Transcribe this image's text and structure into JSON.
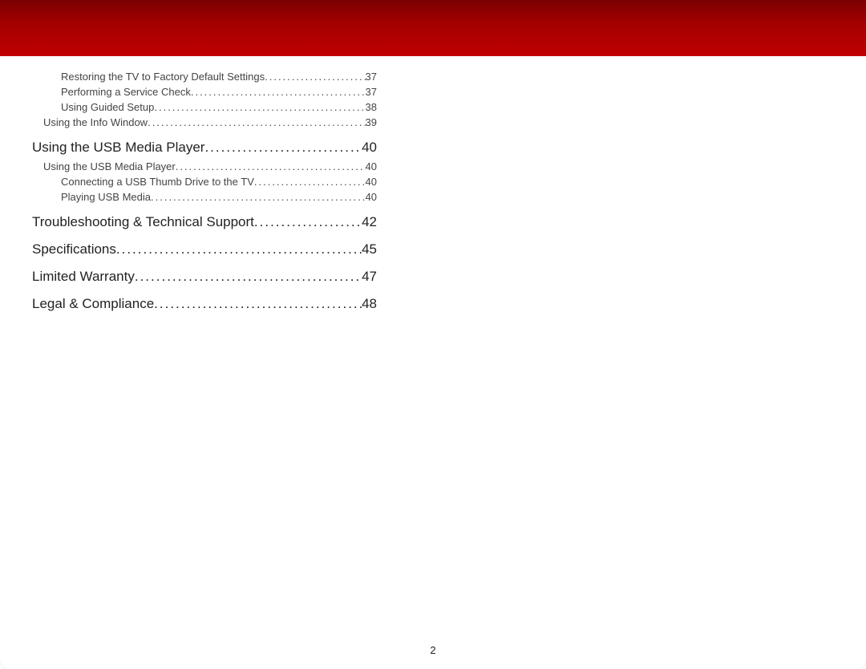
{
  "toc": [
    {
      "level": 3,
      "title": "Restoring the TV to Factory Default Settings",
      "page": "37"
    },
    {
      "level": 3,
      "title": "Performing a Service Check",
      "page": "37"
    },
    {
      "level": 3,
      "title": "Using Guided Setup",
      "page": "38"
    },
    {
      "level": 2,
      "title": "Using the Info Window",
      "page": "39"
    },
    {
      "level": 1,
      "title": "Using the USB Media Player",
      "page": "40"
    },
    {
      "level": 2,
      "title": "Using the USB Media Player",
      "page": "40"
    },
    {
      "level": 3,
      "title": "Connecting a USB Thumb Drive to the TV",
      "page": "40"
    },
    {
      "level": 3,
      "title": "Playing USB Media",
      "page": "40"
    },
    {
      "level": 1,
      "title": "Troubleshooting & Technical Support",
      "page": "42"
    },
    {
      "level": 1,
      "title": "Specifications",
      "page": "45"
    },
    {
      "level": 1,
      "title": "Limited Warranty",
      "page": "47"
    },
    {
      "level": 1,
      "title": "Legal & Compliance",
      "page": "48"
    }
  ],
  "page_number": "2"
}
